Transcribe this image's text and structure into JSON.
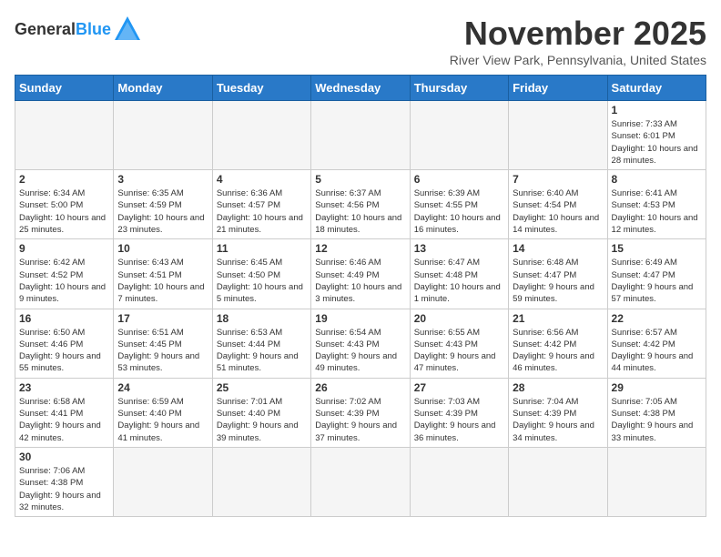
{
  "header": {
    "logo_line1": "General",
    "logo_line2": "Blue",
    "month": "November 2025",
    "location": "River View Park, Pennsylvania, United States"
  },
  "weekdays": [
    "Sunday",
    "Monday",
    "Tuesday",
    "Wednesday",
    "Thursday",
    "Friday",
    "Saturday"
  ],
  "weeks": [
    [
      {
        "day": "",
        "info": ""
      },
      {
        "day": "",
        "info": ""
      },
      {
        "day": "",
        "info": ""
      },
      {
        "day": "",
        "info": ""
      },
      {
        "day": "",
        "info": ""
      },
      {
        "day": "",
        "info": ""
      },
      {
        "day": "1",
        "info": "Sunrise: 7:33 AM\nSunset: 6:01 PM\nDaylight: 10 hours and 28 minutes."
      }
    ],
    [
      {
        "day": "2",
        "info": "Sunrise: 6:34 AM\nSunset: 5:00 PM\nDaylight: 10 hours and 25 minutes."
      },
      {
        "day": "3",
        "info": "Sunrise: 6:35 AM\nSunset: 4:59 PM\nDaylight: 10 hours and 23 minutes."
      },
      {
        "day": "4",
        "info": "Sunrise: 6:36 AM\nSunset: 4:57 PM\nDaylight: 10 hours and 21 minutes."
      },
      {
        "day": "5",
        "info": "Sunrise: 6:37 AM\nSunset: 4:56 PM\nDaylight: 10 hours and 18 minutes."
      },
      {
        "day": "6",
        "info": "Sunrise: 6:39 AM\nSunset: 4:55 PM\nDaylight: 10 hours and 16 minutes."
      },
      {
        "day": "7",
        "info": "Sunrise: 6:40 AM\nSunset: 4:54 PM\nDaylight: 10 hours and 14 minutes."
      },
      {
        "day": "8",
        "info": "Sunrise: 6:41 AM\nSunset: 4:53 PM\nDaylight: 10 hours and 12 minutes."
      }
    ],
    [
      {
        "day": "9",
        "info": "Sunrise: 6:42 AM\nSunset: 4:52 PM\nDaylight: 10 hours and 9 minutes."
      },
      {
        "day": "10",
        "info": "Sunrise: 6:43 AM\nSunset: 4:51 PM\nDaylight: 10 hours and 7 minutes."
      },
      {
        "day": "11",
        "info": "Sunrise: 6:45 AM\nSunset: 4:50 PM\nDaylight: 10 hours and 5 minutes."
      },
      {
        "day": "12",
        "info": "Sunrise: 6:46 AM\nSunset: 4:49 PM\nDaylight: 10 hours and 3 minutes."
      },
      {
        "day": "13",
        "info": "Sunrise: 6:47 AM\nSunset: 4:48 PM\nDaylight: 10 hours and 1 minute."
      },
      {
        "day": "14",
        "info": "Sunrise: 6:48 AM\nSunset: 4:47 PM\nDaylight: 9 hours and 59 minutes."
      },
      {
        "day": "15",
        "info": "Sunrise: 6:49 AM\nSunset: 4:47 PM\nDaylight: 9 hours and 57 minutes."
      }
    ],
    [
      {
        "day": "16",
        "info": "Sunrise: 6:50 AM\nSunset: 4:46 PM\nDaylight: 9 hours and 55 minutes."
      },
      {
        "day": "17",
        "info": "Sunrise: 6:51 AM\nSunset: 4:45 PM\nDaylight: 9 hours and 53 minutes."
      },
      {
        "day": "18",
        "info": "Sunrise: 6:53 AM\nSunset: 4:44 PM\nDaylight: 9 hours and 51 minutes."
      },
      {
        "day": "19",
        "info": "Sunrise: 6:54 AM\nSunset: 4:43 PM\nDaylight: 9 hours and 49 minutes."
      },
      {
        "day": "20",
        "info": "Sunrise: 6:55 AM\nSunset: 4:43 PM\nDaylight: 9 hours and 47 minutes."
      },
      {
        "day": "21",
        "info": "Sunrise: 6:56 AM\nSunset: 4:42 PM\nDaylight: 9 hours and 46 minutes."
      },
      {
        "day": "22",
        "info": "Sunrise: 6:57 AM\nSunset: 4:42 PM\nDaylight: 9 hours and 44 minutes."
      }
    ],
    [
      {
        "day": "23",
        "info": "Sunrise: 6:58 AM\nSunset: 4:41 PM\nDaylight: 9 hours and 42 minutes."
      },
      {
        "day": "24",
        "info": "Sunrise: 6:59 AM\nSunset: 4:40 PM\nDaylight: 9 hours and 41 minutes."
      },
      {
        "day": "25",
        "info": "Sunrise: 7:01 AM\nSunset: 4:40 PM\nDaylight: 9 hours and 39 minutes."
      },
      {
        "day": "26",
        "info": "Sunrise: 7:02 AM\nSunset: 4:39 PM\nDaylight: 9 hours and 37 minutes."
      },
      {
        "day": "27",
        "info": "Sunrise: 7:03 AM\nSunset: 4:39 PM\nDaylight: 9 hours and 36 minutes."
      },
      {
        "day": "28",
        "info": "Sunrise: 7:04 AM\nSunset: 4:39 PM\nDaylight: 9 hours and 34 minutes."
      },
      {
        "day": "29",
        "info": "Sunrise: 7:05 AM\nSunset: 4:38 PM\nDaylight: 9 hours and 33 minutes."
      }
    ],
    [
      {
        "day": "30",
        "info": "Sunrise: 7:06 AM\nSunset: 4:38 PM\nDaylight: 9 hours and 32 minutes."
      },
      {
        "day": "",
        "info": ""
      },
      {
        "day": "",
        "info": ""
      },
      {
        "day": "",
        "info": ""
      },
      {
        "day": "",
        "info": ""
      },
      {
        "day": "",
        "info": ""
      },
      {
        "day": "",
        "info": ""
      }
    ]
  ]
}
